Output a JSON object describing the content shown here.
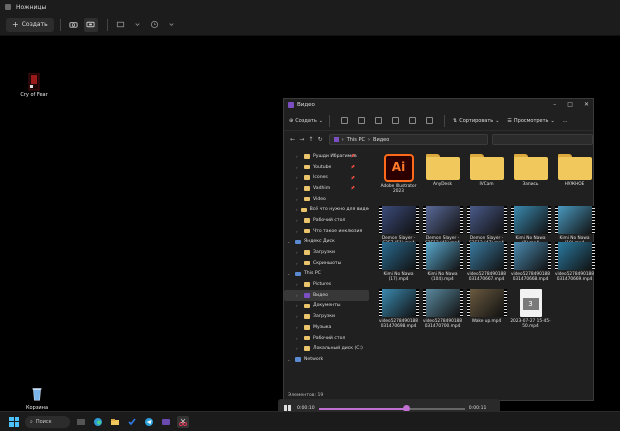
{
  "snip": {
    "title": "Ножницы",
    "new_label": "Создать"
  },
  "desktop": {
    "icons": [
      {
        "label": "Cry of Fear"
      },
      {
        "label": "Корзина"
      }
    ]
  },
  "explorer": {
    "title": "Видео",
    "commands": {
      "create": "Создать",
      "sort": "Сортировать",
      "view": "Просмотреть",
      "more": "..."
    },
    "address": {
      "root": "This PC",
      "current": "Видео"
    },
    "nav": [
      {
        "label": "Рушди Ибрагимов",
        "type": "folder",
        "pinned": true
      },
      {
        "label": "Youtube",
        "type": "folder",
        "pinned": true
      },
      {
        "label": "Icones",
        "type": "folder",
        "pinned": true
      },
      {
        "label": "Vadhim",
        "type": "folder",
        "pinned": true
      },
      {
        "label": "Video",
        "type": "folder"
      },
      {
        "label": "Всё что нужно для видео",
        "type": "folder"
      },
      {
        "label": "Рабочий стол",
        "type": "folder"
      },
      {
        "label": "Что такое инклюзия",
        "type": "folder"
      },
      {
        "label": "Яндекс Диск",
        "type": "root"
      },
      {
        "label": "Загрузки",
        "type": "folder"
      },
      {
        "label": "Скриншоты",
        "type": "folder"
      },
      {
        "label": "This PC",
        "type": "root"
      },
      {
        "label": "Pictures",
        "type": "folder"
      },
      {
        "label": "Видео",
        "type": "folder",
        "selected": true
      },
      {
        "label": "Документы",
        "type": "folder"
      },
      {
        "label": "Загрузки",
        "type": "folder"
      },
      {
        "label": "Музыка",
        "type": "folder"
      },
      {
        "label": "Рабочий стол",
        "type": "folder"
      },
      {
        "label": "Локальный диск (C:)",
        "type": "folder"
      },
      {
        "label": "Network",
        "type": "root"
      }
    ],
    "files": [
      {
        "name": "Adobe Illustrator 2023",
        "kind": "ai"
      },
      {
        "name": "AnyDesk",
        "kind": "folder"
      },
      {
        "name": "IVCam",
        "kind": "folder"
      },
      {
        "name": "Запись",
        "kind": "folder"
      },
      {
        "name": "НУЖНОЕ",
        "kind": "folder"
      },
      {
        "name": "Demon Slayer - S2E7 (51).mp4",
        "kind": "video",
        "color": "#3b4a7a"
      },
      {
        "name": "Demon Slayer - S2E12 (41).mp4",
        "kind": "video",
        "color": "#5a6a9a"
      },
      {
        "name": "Demon Slayer - S2E12 (47).mp4",
        "kind": "video",
        "color": "#4a5a8a"
      },
      {
        "name": "Kimi No Nawa (9).mp4",
        "kind": "video",
        "color": "#3a8ab0"
      },
      {
        "name": "Kimi No Nawa (10).mp4",
        "kind": "video",
        "color": "#4a9ac0"
      },
      {
        "name": "Kimi No Nawa (17).mp4",
        "kind": "video",
        "color": "#2a6a90"
      },
      {
        "name": "Kimi No Nawa (104).mp4",
        "kind": "video",
        "color": "#5aaad0"
      },
      {
        "name": "video5278490188 031470667.mp4",
        "kind": "video",
        "color": "#3a7aa0"
      },
      {
        "name": "video5278490188 031470668.mp4",
        "kind": "video",
        "color": "#4a8ab0"
      },
      {
        "name": "video5278490188 031470669.mp4",
        "kind": "video",
        "color": "#2a7aa0"
      },
      {
        "name": "video5278490188 031470698.mp4",
        "kind": "video",
        "color": "#3a8ab0"
      },
      {
        "name": "video5278490188 031470700.mp4",
        "kind": "video",
        "color": "#5a8aa0"
      },
      {
        "name": "Wake up.mp4",
        "kind": "video",
        "color": "#6a5a40"
      },
      {
        "name": "2023-07-27 15-45-50.mp4",
        "kind": "doc"
      }
    ],
    "status": "Элементов: 19"
  },
  "player": {
    "current": "0:00:10",
    "total": "0:00:11",
    "progress": 0.6
  },
  "taskbar": {
    "search_label": "Поиск"
  }
}
